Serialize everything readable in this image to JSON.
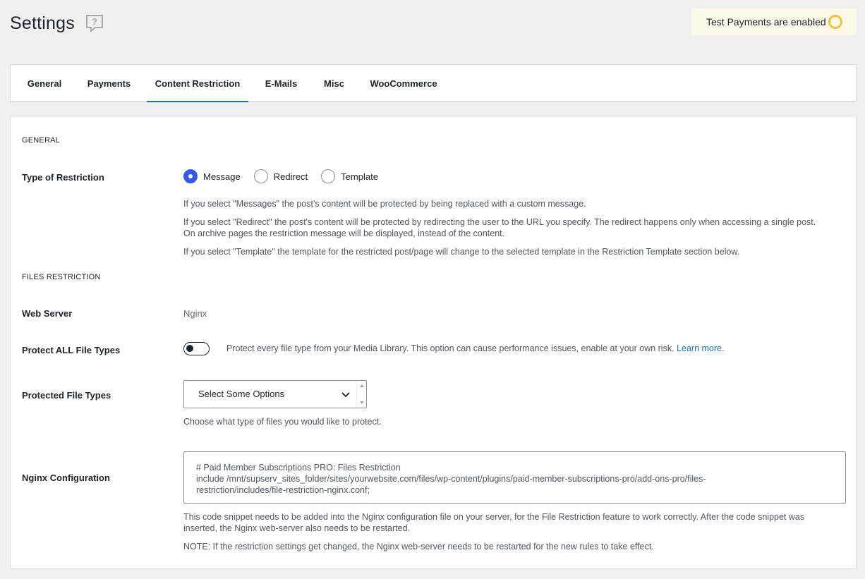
{
  "page": {
    "title": "Settings"
  },
  "test_badge": {
    "text": "Test Payments are enabled",
    "ring_color": "#f0c33c"
  },
  "tabs": [
    {
      "label": "General",
      "active": false
    },
    {
      "label": "Payments",
      "active": false
    },
    {
      "label": "Content Restriction",
      "active": true
    },
    {
      "label": "E-Mails",
      "active": false
    },
    {
      "label": "Misc",
      "active": false
    },
    {
      "label": "WooCommerce",
      "active": false
    }
  ],
  "general": {
    "section_title": "GENERAL",
    "restriction_label": "Type of Restriction",
    "options": [
      {
        "label": "Message",
        "checked": true
      },
      {
        "label": "Redirect",
        "checked": false
      },
      {
        "label": "Template",
        "checked": false
      }
    ],
    "desc_message": "If you select \"Messages\" the post's content will be protected by being replaced with a custom message.",
    "desc_redirect_1": "If you select \"Redirect\" the post's content will be protected by redirecting the user to the URL you specify. The redirect happens only when accessing a single post.",
    "desc_redirect_2": "On archive pages the restriction message will be displayed, instead of the content.",
    "desc_template": "If you select \"Template\" the template for the restricted post/page will change to the selected template in the Restriction Template section below."
  },
  "files": {
    "section_title": "FILES RESTRICTION",
    "web_server_label": "Web Server",
    "web_server_value": "Nginx",
    "protect_all_label": "Protect ALL File Types",
    "protect_all_on": false,
    "protect_all_desc": "Protect every file type from your Media Library. This option can cause performance issues, enable at your own risk.",
    "learn_more": "Learn more.",
    "protected_types_label": "Protected File Types",
    "select_placeholder": "Select Some Options",
    "protected_types_desc": "Choose what type of files you would like to protect.",
    "nginx_label": "Nginx Configuration",
    "nginx_code_line1": "# Paid Member Subscriptions PRO: Files Restriction",
    "nginx_code_line2": "include /mnt/supserv_sites_folder/sites/yourwebsite.com/files/wp-content/plugins/paid-member-subscriptions-pro/add-ons-pro/files-",
    "nginx_code_line3": "restriction/includes/file-restriction-nginx.conf;",
    "nginx_desc_1": "This code snippet needs to be added into the Nginx configuration file on your server, for the File Restriction feature to work correctly. After the code snippet was",
    "nginx_desc_2": "inserted, the Nginx web-server also needs to be restarted.",
    "nginx_note": "NOTE: If the restriction settings get changed, the Nginx web-server needs to be restarted for the new rules to take effect."
  },
  "colors": {
    "accent": "#3858e9",
    "tab_underline": "#2271b1",
    "link": "#2271b1"
  }
}
